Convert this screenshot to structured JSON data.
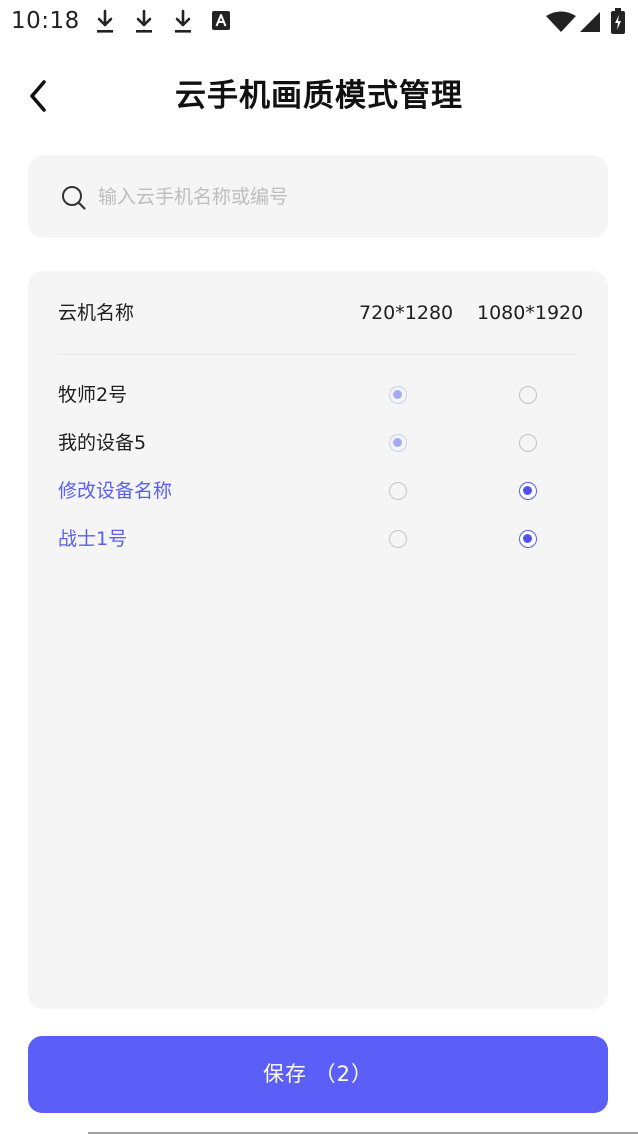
{
  "status_bar": {
    "time": "10:18",
    "notification_icons": [
      "download-icon",
      "download-icon",
      "download-icon",
      "translate-a-icon"
    ],
    "system_icons": [
      "wifi-icon",
      "signal-icon",
      "battery-charging-icon"
    ]
  },
  "header": {
    "back_icon": "chevron-left-icon",
    "title": "云手机画质模式管理"
  },
  "search": {
    "icon": "search-icon",
    "placeholder": "输入云手机名称或编号",
    "value": ""
  },
  "table": {
    "columns": {
      "name": "云机名称",
      "res_720": "720*1280",
      "res_1080": "1080*1920"
    },
    "rows": [
      {
        "name": "牧师2号",
        "selected": "720*1280",
        "changed": false
      },
      {
        "name": "我的设备5",
        "selected": "720*1280",
        "changed": false
      },
      {
        "name": "修改设备名称",
        "selected": "1080*1920",
        "changed": true
      },
      {
        "name": "战士1号",
        "selected": "1080*1920",
        "changed": true
      }
    ]
  },
  "save_button": {
    "label": "保存 （2）"
  },
  "colors": {
    "accent": "#5b5ff8",
    "changed_text": "#5a5ff0",
    "card_background": "#f5f5f5",
    "placeholder": "#bdbdbd"
  }
}
